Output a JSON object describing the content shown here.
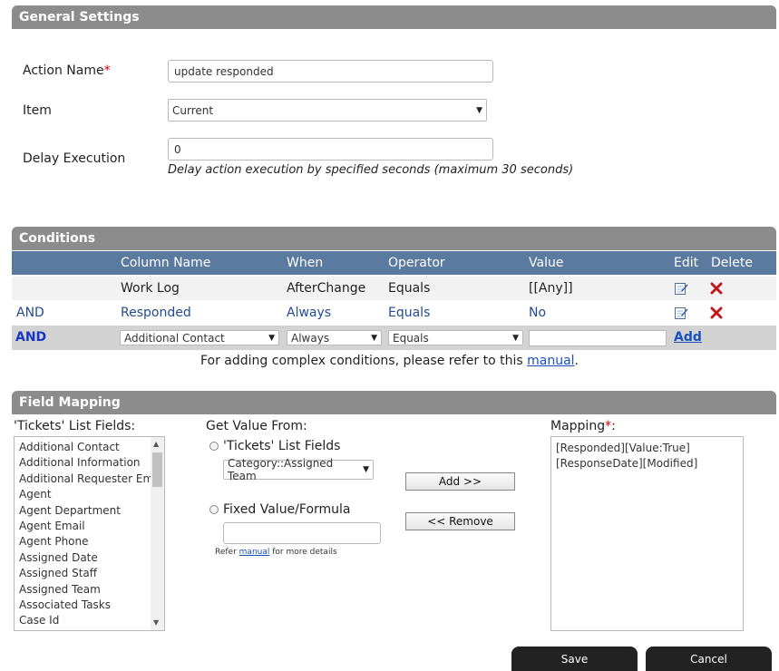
{
  "general_settings": {
    "title": "General Settings",
    "action_name": {
      "label": "Action Name",
      "required_mark": "*",
      "value": "update responded"
    },
    "item": {
      "label": "Item",
      "selected": "Current"
    },
    "delay": {
      "label": "Delay Execution",
      "value": "0",
      "hint": "Delay action execution by specified seconds (maximum 30 seconds)"
    }
  },
  "conditions": {
    "title": "Conditions",
    "headers": {
      "column_name": "Column Name",
      "when": "When",
      "operator": "Operator",
      "value": "Value",
      "edit": "Edit",
      "delete": "Delete"
    },
    "rows": [
      {
        "join": "",
        "column": "Work Log",
        "when": "AfterChange",
        "operator": "Equals",
        "value": "[[Any]]"
      },
      {
        "join": "AND",
        "column": "Responded",
        "when": "Always",
        "operator": "Equals",
        "value": "No"
      }
    ],
    "new_row": {
      "join": "AND",
      "column": "Additional Contact",
      "when": "Always",
      "operator": "Equals",
      "value": "",
      "add_label": "Add"
    },
    "note_prefix": "For adding complex conditions, please refer to this ",
    "note_link": "manual",
    "note_suffix": "."
  },
  "field_mapping": {
    "title": "Field Mapping",
    "list_label": "'Tickets' List Fields:",
    "list_items": [
      "Additional Contact",
      "Additional Information",
      "Additional Requester Email",
      "Agent",
      "Agent Department",
      "Agent Email",
      "Agent Phone",
      "Assigned Date",
      "Assigned Staff",
      "Assigned Team",
      "Associated Tasks",
      "Case Id"
    ],
    "get_value_label": "Get Value From:",
    "option_list": "'Tickets' List Fields",
    "option_list_selected": "Category::Assigned Team",
    "option_fixed": "Fixed Value/Formula",
    "fixed_value": "",
    "refer_prefix": "Refer ",
    "refer_link": "manual",
    "refer_suffix": " for more details",
    "add_button": "Add >>",
    "remove_button": "<< Remove",
    "mapping_label": "Mapping",
    "mapping_required": "*",
    "mapping_colon": ":",
    "mappings": [
      "[Responded][Value:True]",
      "[ResponseDate][Modified]"
    ]
  },
  "footer": {
    "save": "Save",
    "cancel": "Cancel"
  }
}
